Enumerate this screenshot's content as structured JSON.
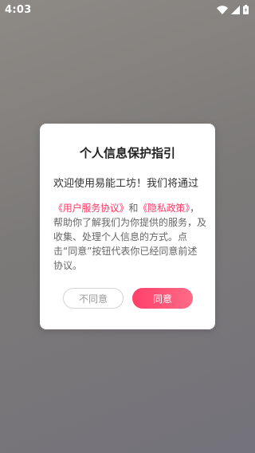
{
  "status_bar": {
    "time": "4:03",
    "icons": [
      "wifi-icon",
      "cellular-signal-icon",
      "battery-icon"
    ]
  },
  "dialog": {
    "title": "个人信息保护指引",
    "greeting": "欢迎使用易能工坊！我们将通过",
    "user_agreement_link": "《用户服务协议》",
    "and": "和",
    "privacy_policy_link": "《隐私政策》",
    "comma": "，",
    "body_text": "帮助你了解我们为你提供的服务，及收集、处理个人信息的方式。点击“同意”按钮代表你已经同意前述协议。",
    "decline_label": "不同意",
    "agree_label": "同意"
  },
  "colors": {
    "accent": "#ff3b67",
    "backdrop": "#7f7c7a"
  }
}
